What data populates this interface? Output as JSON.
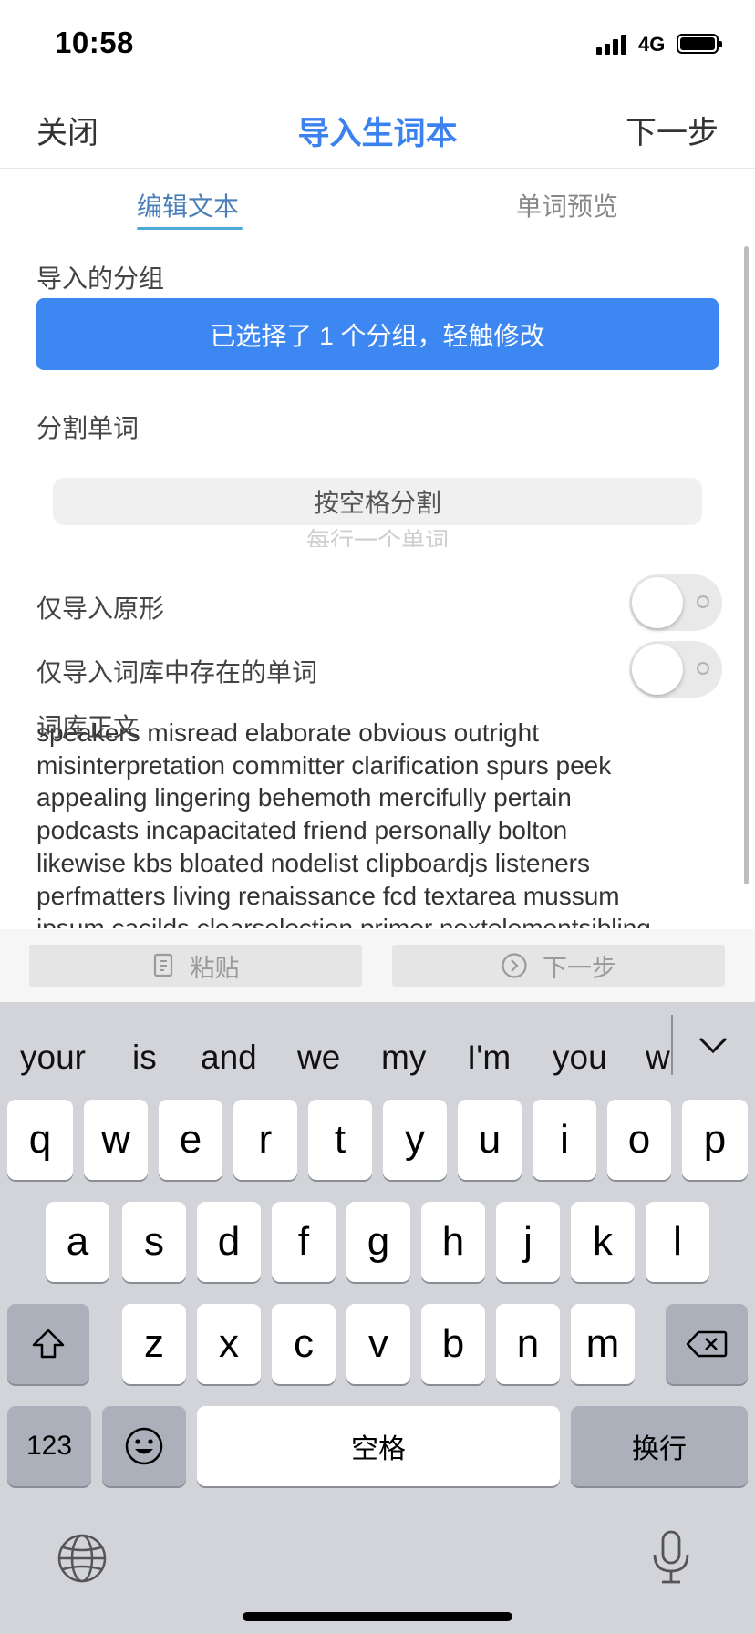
{
  "status_bar": {
    "time": "10:58",
    "network": "4G"
  },
  "nav": {
    "close": "关闭",
    "title": "导入生词本",
    "next": "下一步"
  },
  "tabs": [
    {
      "label": "编辑文本",
      "active": true
    },
    {
      "label": "单词预览",
      "active": false
    }
  ],
  "group": {
    "label": "导入的分组",
    "button": "已选择了 1 个分组，轻触修改"
  },
  "split": {
    "label": "分割单词",
    "selected": "按空格分割",
    "next_option": "每行一个单词"
  },
  "options": [
    {
      "label": "仅导入原形",
      "on": false
    },
    {
      "label": "仅导入词库中存在的单词",
      "on": false
    }
  ],
  "body": {
    "label": "词库正文",
    "lines": [
      "speakers misread elaborate obvious outright",
      "misinterpretation committer clarification spurs peek",
      "appealing lingering behemoth mercifully pertain",
      "podcasts incapacitated friend personally bolton",
      "likewise kbs bloated nodelist clipboardjs listeners",
      "perfmatters living renaissance fcd textarea mussum",
      "ipsum cacilds clearselection primer nextelementsibling"
    ]
  },
  "accessory": {
    "paste": "粘贴",
    "next": "下一步"
  },
  "keyboard": {
    "suggestions": [
      "your",
      "is",
      "and",
      "we",
      "my",
      "I'm",
      "you",
      "w"
    ],
    "row1": [
      "q",
      "w",
      "e",
      "r",
      "t",
      "y",
      "u",
      "i",
      "o",
      "p"
    ],
    "row2": [
      "a",
      "s",
      "d",
      "f",
      "g",
      "h",
      "j",
      "k",
      "l"
    ],
    "row3": [
      "z",
      "x",
      "c",
      "v",
      "b",
      "n",
      "m"
    ],
    "numbers": "123",
    "space": "空格",
    "return": "换行"
  }
}
